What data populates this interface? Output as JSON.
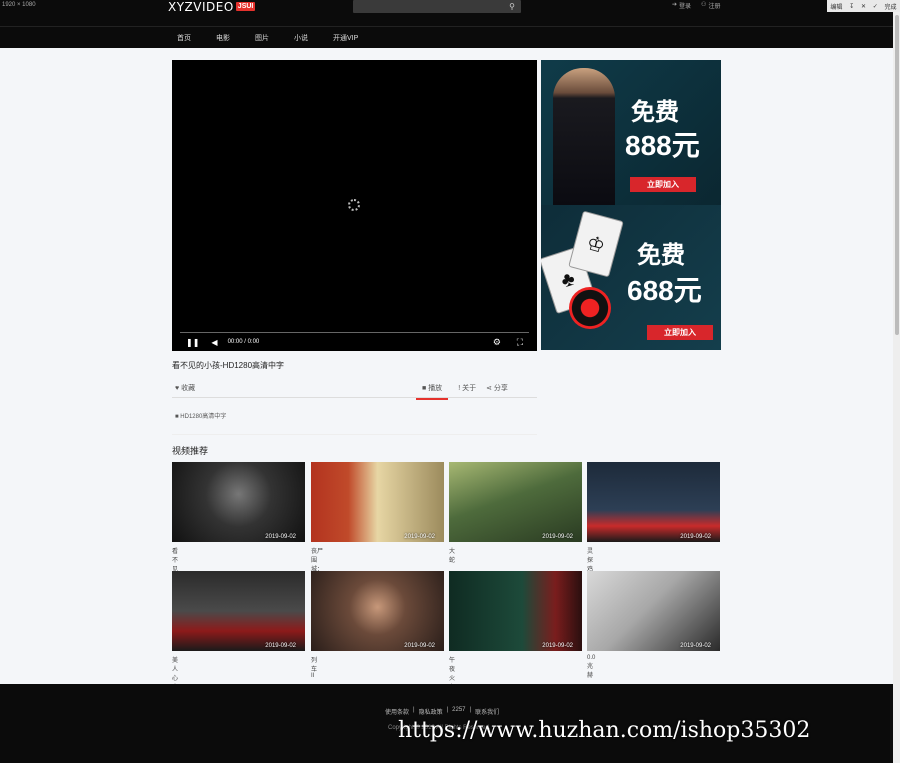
{
  "screen": {
    "dims_label": "1920 × 1080"
  },
  "header": {
    "logo_text": "XYZVIDEO",
    "logo_badge": "JSUI",
    "login": "登录",
    "register": "注册"
  },
  "toolbox": {
    "edit": "编辑",
    "done": "完成"
  },
  "nav": {
    "items": [
      "首页",
      "电影",
      "图片",
      "小说",
      "开通VIP"
    ]
  },
  "player": {
    "time": "00:00 / 0:00"
  },
  "ads": [
    {
      "free": "免费",
      "amount": "888元",
      "cta": "立即加入"
    },
    {
      "free": "免费",
      "amount": "688元",
      "cta": "立即加入"
    }
  ],
  "video": {
    "title": "看不见的小孩-HD1280高清中字",
    "favorite": "收藏",
    "tabs": [
      "播放",
      "关于",
      "分享"
    ],
    "source": "HD1280高清中字"
  },
  "recommend": {
    "title": "视频推荐",
    "items": [
      {
        "title": "看不见的小孩",
        "date": "2019-09-02"
      },
      {
        "title": "丧尸围城：血路",
        "date": "2019-09-02"
      },
      {
        "title": "大蛇",
        "date": "2019-09-02"
      },
      {
        "title": "灵探鸡迷华",
        "date": "2019-09-02"
      },
      {
        "title": "美人心蛊",
        "date": "2019-09-02"
      },
      {
        "title": "列车II",
        "date": "2019-09-02"
      },
      {
        "title": "午夜火车",
        "date": "2019-09-02"
      },
      {
        "title": "0.0兆赫",
        "date": "2019-09-02"
      }
    ]
  },
  "footer": {
    "links": [
      "使用条款",
      "隐私政策",
      "2257",
      "联系我们"
    ],
    "copyright": "Copyright © 2019 All Rights Reserved."
  },
  "watermark": "https://www.huzhan.com/ishop35302",
  "colors": {
    "accent": "#e5322d",
    "dark": "#0b0b0b",
    "page_bg": "#f4f6f9"
  }
}
